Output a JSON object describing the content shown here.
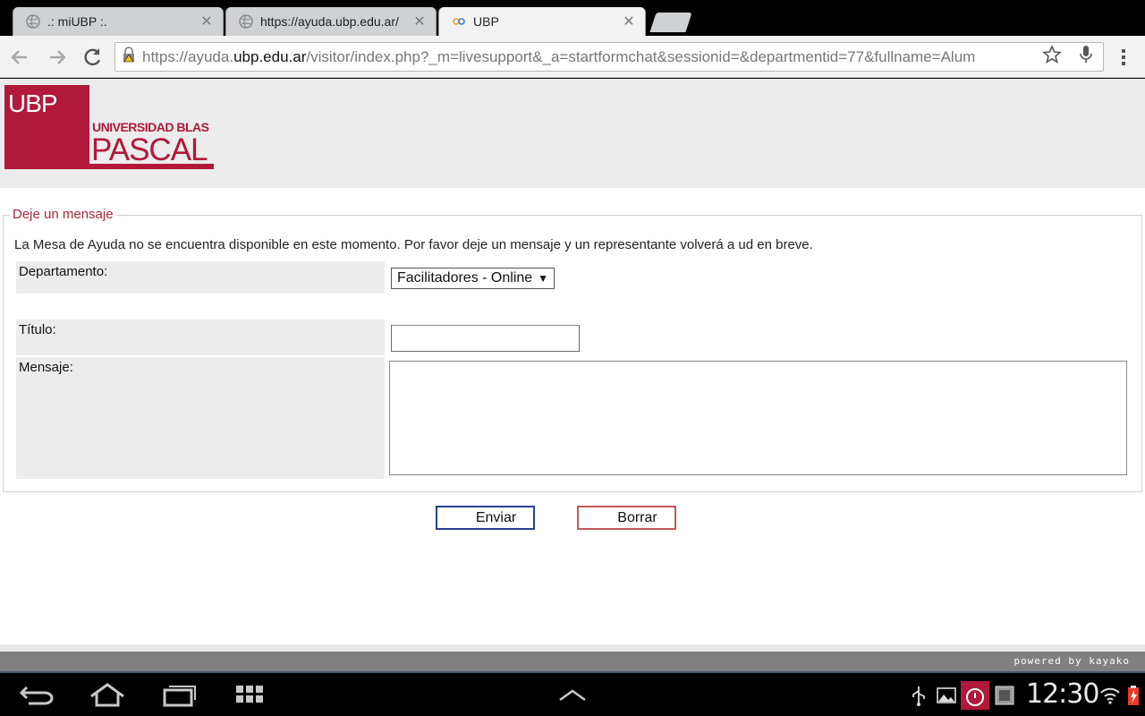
{
  "browser": {
    "tabs": [
      {
        "title": ".: miUBP :.",
        "active": false,
        "icon": "globe-icon"
      },
      {
        "title": "https://ayuda.ubp.edu.ar/",
        "active": false,
        "icon": "globe-icon"
      },
      {
        "title": "UBP",
        "active": true,
        "icon": "kayako-icon"
      }
    ],
    "close_glyph": "✕",
    "url_prefix": "https://ayuda.",
    "url_host": "ubp.edu.ar",
    "url_path": "/visitor/index.php?_m=livesupport&_a=startformchat&sessionid=&departmentid=77&fullname=Alum"
  },
  "logo": {
    "short": "UBP",
    "line1": "UNIVERSIDAD BLAS",
    "line2": "PASCAL",
    "brand_color": "#b0193a"
  },
  "form": {
    "legend": "Deje un mensaje",
    "intro": "La Mesa de Ayuda no se encuentra disponible en este momento. Por favor deje un mensaje y un representante volverá a ud en breve.",
    "department_label": "Departamento:",
    "department_value": "Facilitadores - Online",
    "title_label": "Título:",
    "title_value": "",
    "message_label": "Mensaje:",
    "message_value": "",
    "send_label": "Enviar",
    "clear_label": "Borrar"
  },
  "footer": {
    "powered_by": "powered by kayako"
  },
  "system": {
    "time": "12:30"
  },
  "colors": {
    "legend": "#a52a3a",
    "send_border": "#2b3f8e",
    "clear_border": "#c45858"
  }
}
